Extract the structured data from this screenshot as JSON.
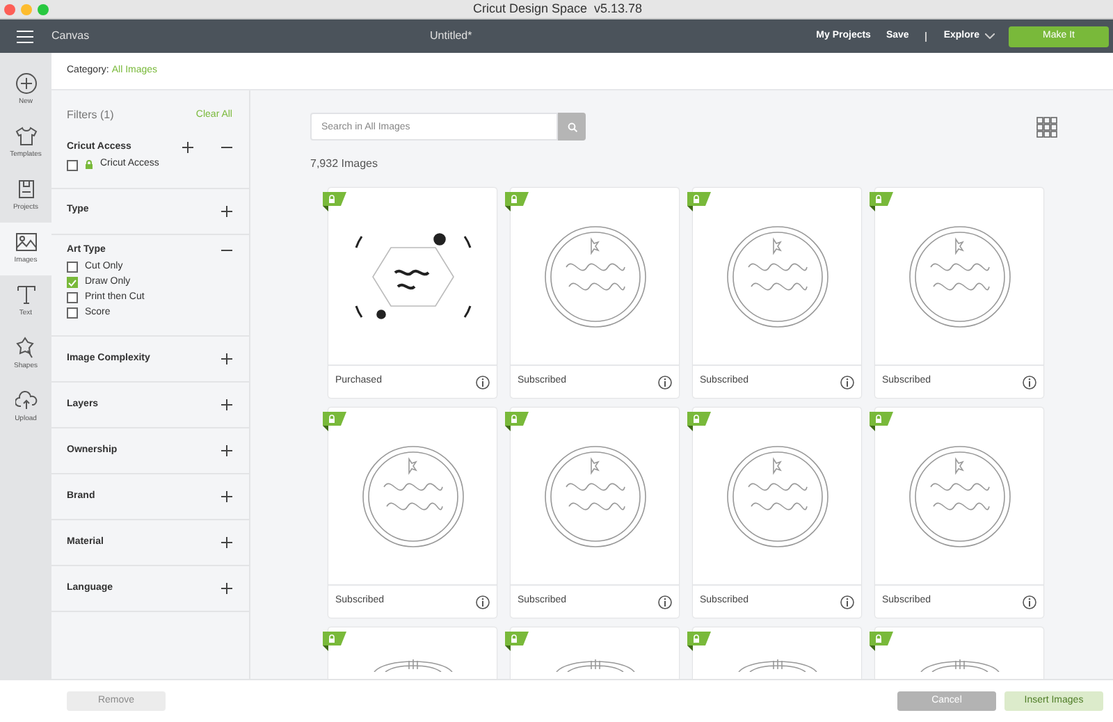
{
  "window": {
    "title": "Cricut Design Space  v5.13.78"
  },
  "header": {
    "section": "Canvas",
    "document": "Untitled*",
    "links": [
      "My Projects",
      "Save"
    ],
    "explore": "Explore",
    "primary_button": "Make It"
  },
  "rail": [
    {
      "label": "New",
      "selected": false
    },
    {
      "label": "Templates",
      "selected": false
    },
    {
      "label": "Projects",
      "selected": false
    },
    {
      "label": "Images",
      "selected": true
    },
    {
      "label": "Text",
      "selected": false
    },
    {
      "label": "Shapes",
      "selected": false
    },
    {
      "label": "Upload",
      "selected": false
    }
  ],
  "category": {
    "label": "Category:",
    "value": "All Images"
  },
  "filters": {
    "title": "Filters (1)",
    "clear": "Clear All",
    "sections": [
      {
        "label": "Cricut Access",
        "expanded": true,
        "options": [
          {
            "label": "Cricut Access",
            "checked": false
          }
        ]
      },
      {
        "label": "Type",
        "expanded": false
      },
      {
        "label": "Art Type",
        "expanded": true,
        "options": [
          {
            "label": "Cut Only",
            "checked": false
          },
          {
            "label": "Draw Only",
            "checked": true
          },
          {
            "label": "Print then Cut",
            "checked": false
          },
          {
            "label": "Score",
            "checked": false
          }
        ]
      },
      {
        "label": "Image Complexity",
        "expanded": false
      },
      {
        "label": "Layers",
        "expanded": false
      },
      {
        "label": "Ownership",
        "expanded": false
      },
      {
        "label": "Brand",
        "expanded": false
      },
      {
        "label": "Material",
        "expanded": false
      },
      {
        "label": "Language",
        "expanded": false
      }
    ]
  },
  "search": {
    "placeholder": "Search in All Images"
  },
  "result_count": "7,932 Images",
  "cards": [
    {
      "status": "Purchased",
      "cut_off": false
    },
    {
      "status": "Subscribed",
      "cut_off": false
    },
    {
      "status": "Subscribed",
      "cut_off": false
    },
    {
      "status": "Subscribed",
      "cut_off": false
    },
    {
      "status": "Subscribed",
      "cut_off": false
    },
    {
      "status": "Subscribed",
      "cut_off": false
    },
    {
      "status": "Subscribed",
      "cut_off": false
    },
    {
      "status": "Subscribed",
      "cut_off": false
    },
    {
      "cut_off": true
    },
    {
      "cut_off": true
    },
    {
      "cut_off": true
    },
    {
      "cut_off": true
    }
  ],
  "footer": {
    "remove": "Remove",
    "cancel": "Cancel",
    "insert": "Insert Images"
  }
}
